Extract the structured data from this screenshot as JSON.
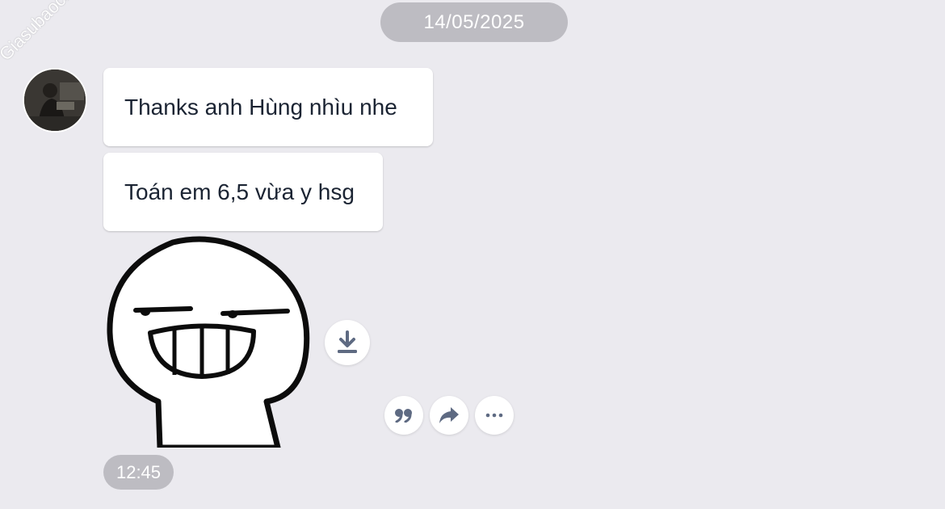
{
  "chat": {
    "date_label": "14/05/2025",
    "watermark": "Giasubaochau.net",
    "messages": [
      {
        "text": "Thanks anh Hùng nhìu nhe"
      },
      {
        "text": "Toán em 6,5 vừa y hsg"
      }
    ],
    "sticker": {
      "icon": "grinning-stickman-sticker",
      "download_icon": "download-icon"
    },
    "actions": [
      {
        "icon": "quote-icon"
      },
      {
        "icon": "forward-icon"
      },
      {
        "icon": "more-icon"
      }
    ],
    "time_label": "12:45"
  },
  "colors": {
    "background": "#ebeaef",
    "pill": "#bdbcc2",
    "bubble": "#ffffff",
    "text": "#1b2433",
    "icon": "#5e6a82"
  }
}
